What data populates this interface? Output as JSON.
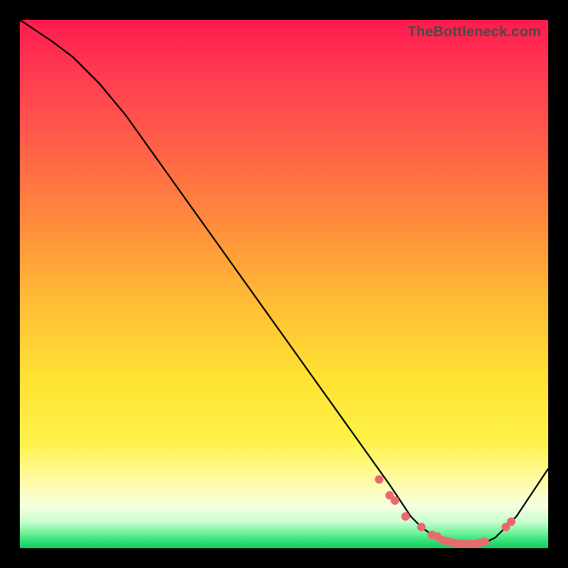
{
  "watermark": "TheBottleneck.com",
  "chart_data": {
    "type": "line",
    "title": "",
    "xlabel": "",
    "ylabel": "",
    "xlim": [
      0,
      100
    ],
    "ylim": [
      0,
      100
    ],
    "grid": false,
    "background_gradient": [
      "#ff1a4d",
      "#ff8a3c",
      "#ffe233",
      "#fffcae",
      "#17c95f"
    ],
    "series": [
      {
        "name": "bottleneck-curve",
        "color": "#000000",
        "x": [
          0,
          3,
          6,
          10,
          15,
          20,
          25,
          30,
          35,
          40,
          45,
          50,
          55,
          60,
          65,
          70,
          72,
          74,
          76,
          78,
          80,
          82,
          84,
          86,
          88,
          90,
          92,
          94,
          96,
          98,
          100
        ],
        "y": [
          100,
          98,
          96,
          93,
          88,
          82,
          75,
          68,
          61,
          54,
          47,
          40,
          33,
          26,
          19,
          12,
          9,
          6,
          4,
          2.5,
          1.5,
          1,
          0.8,
          0.8,
          1,
          2,
          4,
          6,
          9,
          12,
          15
        ]
      }
    ],
    "highlight_points": {
      "name": "sample-dots",
      "color": "#e86a6f",
      "x": [
        68,
        70,
        71,
        73,
        76,
        78,
        79,
        80,
        81,
        82,
        83,
        84,
        85,
        86,
        87,
        88,
        92,
        93
      ],
      "y": [
        13,
        10,
        9,
        6,
        4,
        2.5,
        2.2,
        1.5,
        1.3,
        1,
        0.9,
        0.8,
        0.8,
        0.8,
        1,
        1.2,
        4,
        5
      ]
    }
  }
}
